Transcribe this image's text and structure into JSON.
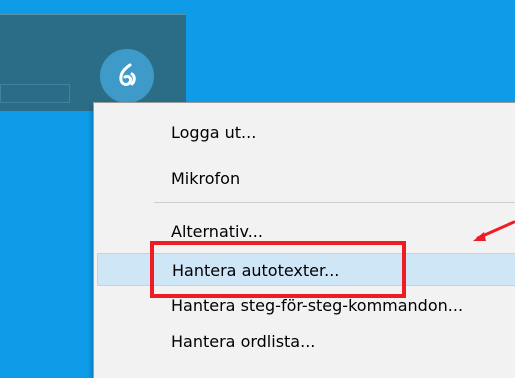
{
  "menu": {
    "items": [
      {
        "label": "Logga ut..."
      },
      {
        "label": "Mikrofon"
      },
      {
        "label": "Alternativ..."
      },
      {
        "label": "Hantera autotexter..."
      },
      {
        "label": "Hantera steg-för-steg-kommandon..."
      },
      {
        "label": "Hantera ordlista..."
      }
    ],
    "highlighted_item": "Hantera autotexter..."
  },
  "colors": {
    "desktop": "#0e9be8",
    "app_bar": "#2b6d87",
    "menu_background": "#f2f2f2",
    "highlight": "#cfe6f6",
    "annotation": "#ee1c24"
  },
  "icons": {
    "app": "dragon-logo-icon",
    "annotation": "red-arrow-icon"
  }
}
